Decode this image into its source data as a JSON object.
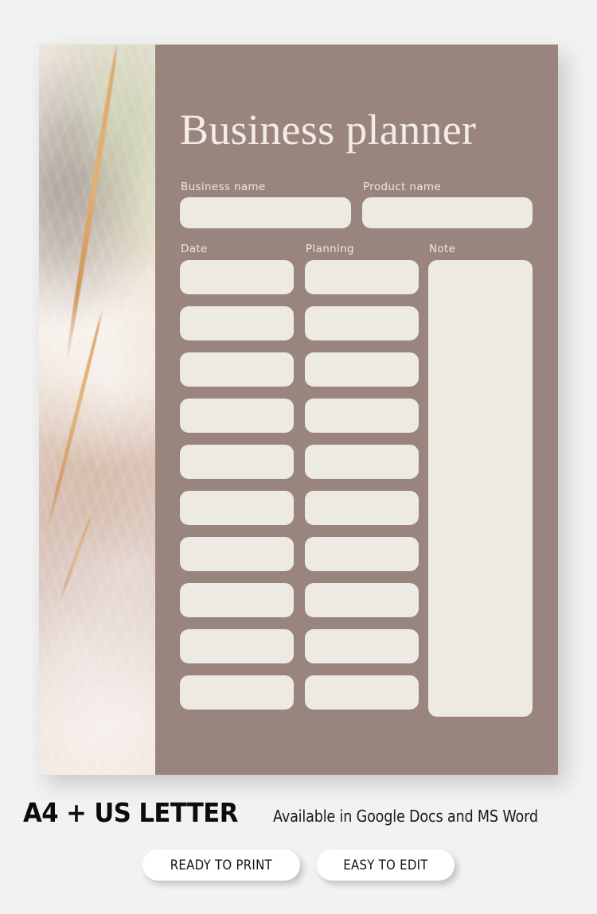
{
  "document": {
    "title": "Business planner",
    "panel_color": "#9a847e",
    "field_color": "#ede9e3",
    "page_background": "#f2f2f2"
  },
  "photo": {
    "name": "marble-onyx-texture",
    "description": "Cream and blush onyx marble slab with a golden diagonal vein"
  },
  "form": {
    "name_fields": [
      {
        "label": "Business name",
        "value": "",
        "placeholder": ""
      },
      {
        "label": "Product name",
        "value": "",
        "placeholder": ""
      }
    ],
    "columns": [
      {
        "label": "Date",
        "type": "rows",
        "row_count": 10
      },
      {
        "label": "Planning",
        "type": "rows",
        "row_count": 10
      },
      {
        "label": "Note",
        "type": "textarea",
        "value": "",
        "placeholder": ""
      }
    ],
    "row_values": {
      "date": [
        "",
        "",
        "",
        "",
        "",
        "",
        "",
        "",
        "",
        ""
      ],
      "planning": [
        "",
        "",
        "",
        "",
        "",
        "",
        "",
        "",
        "",
        ""
      ]
    }
  },
  "footer": {
    "format_title": "A4 + US LETTER",
    "availability": "Available in Google Docs and MS Word",
    "badges": [
      {
        "label": "READY TO PRINT"
      },
      {
        "label": "EASY TO EDIT"
      }
    ]
  }
}
